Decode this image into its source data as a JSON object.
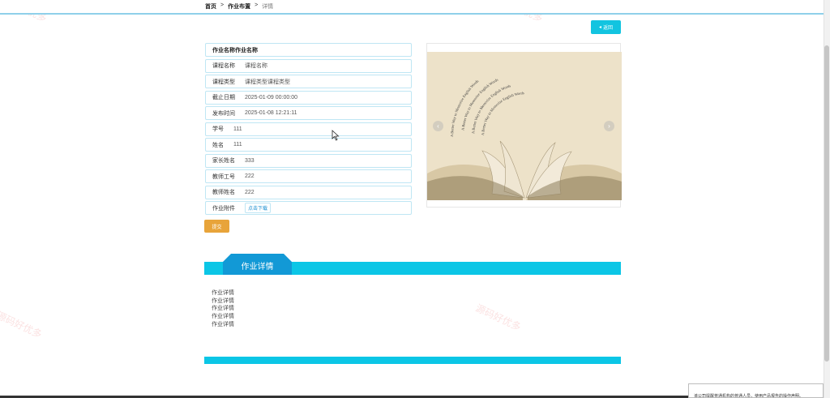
{
  "breadcrumb": {
    "home": "首页",
    "sep": ">",
    "section": "作业布置",
    "current": "详情"
  },
  "back_button": {
    "icon": "caret-left-icon",
    "label": "返回"
  },
  "info": {
    "title": "作业名称作业名称",
    "rows": [
      {
        "key": "课程名称",
        "value": "课程名称"
      },
      {
        "key": "课程类型",
        "value": "课程类型课程类型"
      },
      {
        "key": "截止日期",
        "value": "2025-01-09 00:00:00"
      },
      {
        "key": "发布时间",
        "value": "2025-01-08 12:21:11"
      },
      {
        "key": "学号",
        "value": "111"
      },
      {
        "key": "姓名",
        "value": "111"
      },
      {
        "key": "家长姓名",
        "value": "333"
      },
      {
        "key": "教师工号",
        "value": "222"
      },
      {
        "key": "教师姓名",
        "value": "222"
      }
    ],
    "attachment": {
      "key": "作业附件",
      "link": "点击下载"
    }
  },
  "submit_label": "提交",
  "carousel": {
    "arc_text": "A Better Way to Memorize English Words"
  },
  "detail": {
    "tab_label": "作业详情",
    "lines": [
      "作业详情",
      "作业详情",
      "作业详情",
      "作业详情",
      "作业详情"
    ]
  },
  "notice": "该公司提醒普通机构的普通人员，使用产品报告的操作声明。",
  "watermark": "源码好优多",
  "colors": {
    "accent": "#0bc6e6",
    "tab": "#1299d6",
    "submit": "#e8a43a"
  }
}
